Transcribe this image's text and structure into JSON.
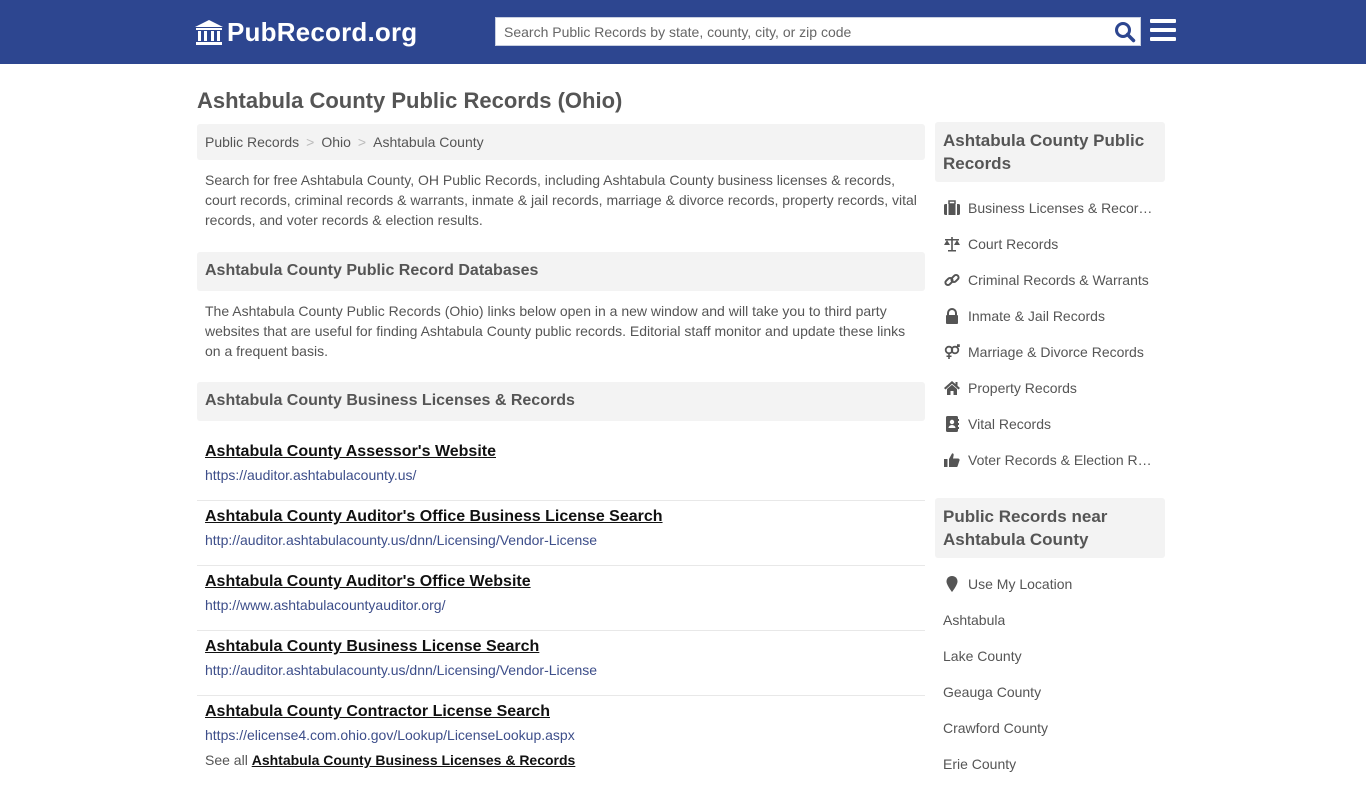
{
  "header": {
    "logo_text": "PubRecord.org",
    "search_placeholder": "Search Public Records by state, county, city, or zip code",
    "brand_color": "#2d4690"
  },
  "page_title": "Ashtabula County Public Records (Ohio)",
  "breadcrumb": [
    "Public Records",
    "Ohio",
    "Ashtabula County"
  ],
  "intro": "Search for free Ashtabula County, OH Public Records, including Ashtabula County business licenses & records, court records, criminal records & warrants, inmate & jail records, marriage & divorce records, property records, vital records, and voter records & election results.",
  "databases": {
    "heading": "Ashtabula County Public Record Databases",
    "text": "The Ashtabula County Public Records (Ohio) links below open in a new window and will take you to third party websites that are useful for finding Ashtabula County public records. Editorial staff monitor and update these links on a frequent basis."
  },
  "business": {
    "heading": "Ashtabula County Business Licenses & Records",
    "links": [
      {
        "title": "Ashtabula County Assessor's Website",
        "url": "https://auditor.ashtabulacounty.us/"
      },
      {
        "title": "Ashtabula County Auditor's Office Business License Search",
        "url": "http://auditor.ashtabulacounty.us/dnn/Licensing/Vendor-License"
      },
      {
        "title": "Ashtabula County Auditor's Office Website",
        "url": "http://www.ashtabulacountyauditor.org/"
      },
      {
        "title": "Ashtabula County Business License Search",
        "url": "http://auditor.ashtabulacounty.us/dnn/Licensing/Vendor-License"
      },
      {
        "title": "Ashtabula County Contractor License Search",
        "url": "https://elicense4.com.ohio.gov/Lookup/LicenseLookup.aspx"
      }
    ],
    "see_all_prefix": "See all",
    "see_all_link": "Ashtabula County Business Licenses & Records"
  },
  "sidebar": {
    "records_heading": "Ashtabula County Public Records",
    "records": [
      {
        "label": "Business Licenses & Records",
        "icon": "briefcase-icon"
      },
      {
        "label": "Court Records",
        "icon": "scale-icon"
      },
      {
        "label": "Criminal Records & Warrants",
        "icon": "link-icon"
      },
      {
        "label": "Inmate & Jail Records",
        "icon": "lock-icon"
      },
      {
        "label": "Marriage & Divorce Records",
        "icon": "gender-icon"
      },
      {
        "label": "Property Records",
        "icon": "home-icon"
      },
      {
        "label": "Vital Records",
        "icon": "address-book-icon"
      },
      {
        "label": "Voter Records & Election Results",
        "icon": "thumbs-up-icon"
      }
    ],
    "nearby_heading": "Public Records near Ashtabula County",
    "use_location": "Use My Location",
    "nearby": [
      "Ashtabula",
      "Lake County",
      "Geauga County",
      "Crawford County",
      "Erie County"
    ]
  }
}
